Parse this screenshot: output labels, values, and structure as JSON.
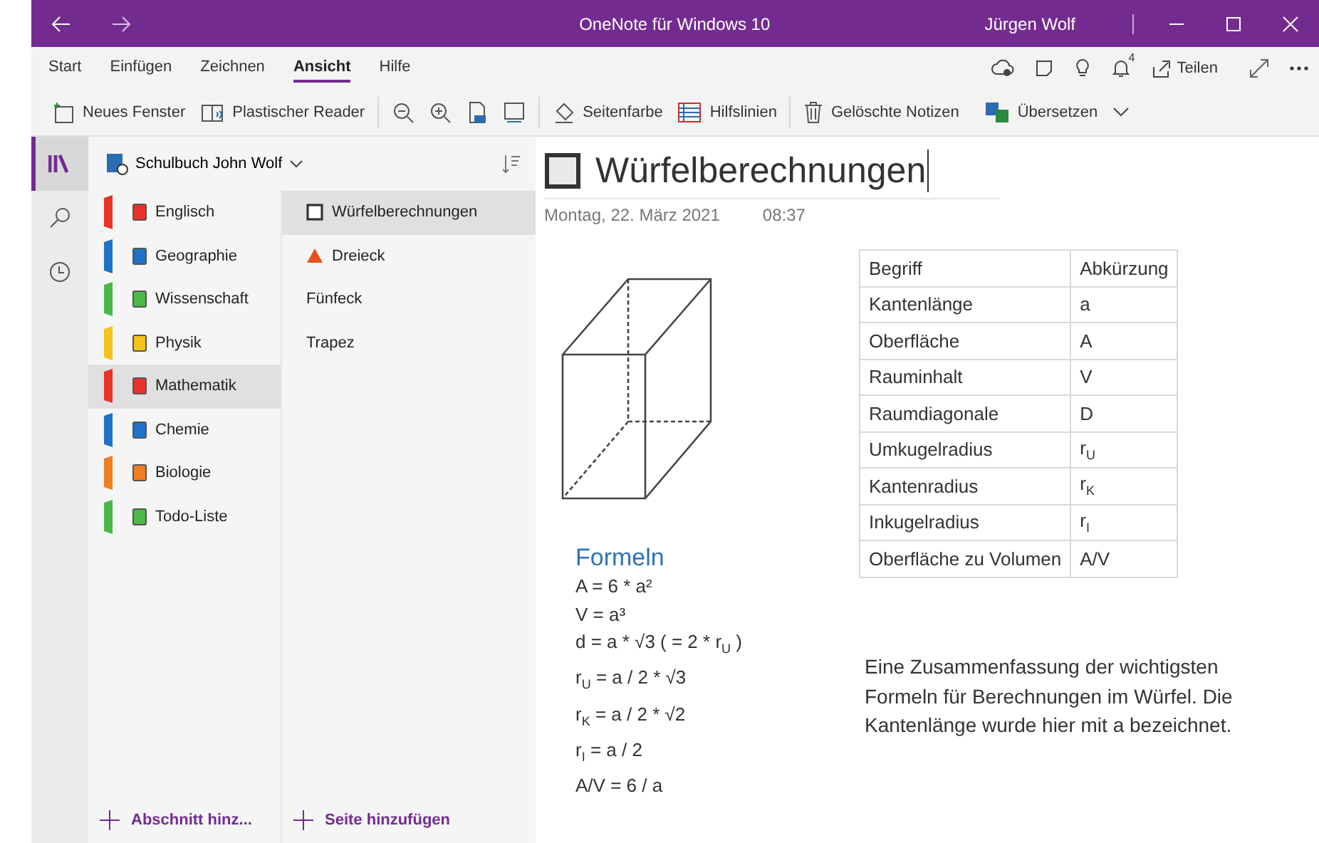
{
  "window": {
    "title": "OneNote für Windows 10",
    "user": "Jürgen Wolf"
  },
  "menu": [
    {
      "label": "Start",
      "selected": false
    },
    {
      "label": "Einfügen",
      "selected": false
    },
    {
      "label": "Zeichnen",
      "selected": false
    },
    {
      "label": "Ansicht",
      "selected": true
    },
    {
      "label": "Hilfe",
      "selected": false
    }
  ],
  "notifications": "4",
  "share": "Teilen",
  "toolbar": [
    "Neues Fenster",
    "Plastischer Reader",
    "Seitenfarbe",
    "Hilfslinien",
    "Gelöschte Notizen",
    "Übersetzen"
  ],
  "notebook": {
    "name": "Schulbuch John Wolf"
  },
  "sections": [
    {
      "name": "Englisch",
      "color": "#e8322a",
      "selected": false
    },
    {
      "name": "Geographie",
      "color": "#1e73c8",
      "selected": false
    },
    {
      "name": "Wissenschaft",
      "color": "#4cb848",
      "selected": false
    },
    {
      "name": "Physik",
      "color": "#f5c21b",
      "selected": false
    },
    {
      "name": "Mathematik",
      "color": "#e8322a",
      "selected": true
    },
    {
      "name": "Chemie",
      "color": "#1e73c8",
      "selected": false
    },
    {
      "name": "Biologie",
      "color": "#f07f22",
      "selected": false
    },
    {
      "name": "Todo-Liste",
      "color": "#4cb848",
      "selected": false
    }
  ],
  "pages": [
    {
      "title": "Würfelberechnungen",
      "kind": "square",
      "selected": true
    },
    {
      "title": "Dreieck",
      "kind": "triangle",
      "selected": false
    },
    {
      "title": "Fünfeck",
      "kind": "plain",
      "selected": false
    },
    {
      "title": "Trapez",
      "kind": "plain",
      "selected": false
    }
  ],
  "add_section": "Abschnitt hinz...",
  "add_page": "Seite hinzufügen",
  "page": {
    "title": "Würfelberechnungen",
    "date": "Montag, 22. März 2021",
    "time": "08:37",
    "table": {
      "columns": [
        "Begriff",
        "Abkürzung"
      ],
      "rows": [
        [
          "Kantenlänge",
          "a"
        ],
        [
          "Oberfläche",
          "A"
        ],
        [
          "Rauminhalt",
          "V"
        ],
        [
          "Raumdiagonale",
          "D"
        ],
        [
          "Umkugelradius",
          "r$_{U}$"
        ],
        [
          "Kantenradius",
          "r$_{K}$"
        ],
        [
          "Inkugelradius",
          "r$_{I}$"
        ],
        [
          "Oberfläche zu Volumen",
          "A/V"
        ]
      ]
    },
    "formulas_heading": "Formeln",
    "formulas": [
      "A = 6 * a²",
      "V = a³",
      "d = a * √3 ( = 2 * r$_{U}$ )",
      "r$_{U}$ = a / 2 * √3",
      "r$_{K}$ = a / 2 * √2",
      "r$_{I}$ = a / 2",
      "A/V = 6 / a"
    ],
    "note": "Eine Zusammenfassung der wichtigsten Formeln für Berechnungen im Würfel. Die Kantenlänge wurde hier mit a bezeichnet."
  }
}
